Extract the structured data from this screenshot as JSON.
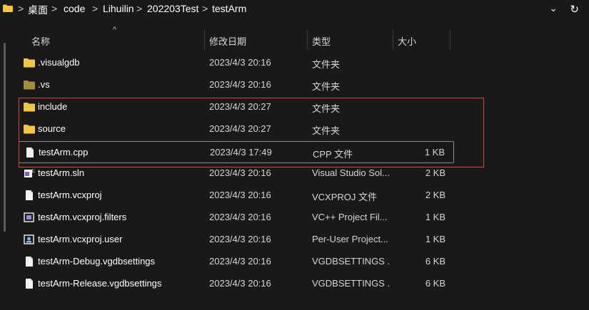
{
  "breadcrumb": {
    "items": [
      "桌面",
      "code",
      "Lihuilin",
      "202203Test",
      "testArm"
    ],
    "separator": ">"
  },
  "columns": {
    "name": "名称",
    "modified": "修改日期",
    "type": "类型",
    "size": "大小"
  },
  "files": [
    {
      "name": ".visualgdb",
      "modified": "2023/4/3 20:16",
      "type": "文件夹",
      "size": "",
      "icon": "folder-icon"
    },
    {
      "name": ".vs",
      "modified": "2023/4/3 20:16",
      "type": "文件夹",
      "size": "",
      "icon": "folder-icon"
    },
    {
      "name": "include",
      "modified": "2023/4/3 20:27",
      "type": "文件夹",
      "size": "",
      "icon": "folder-icon"
    },
    {
      "name": "source",
      "modified": "2023/4/3 20:27",
      "type": "文件夹",
      "size": "",
      "icon": "folder-icon"
    },
    {
      "name": "testArm.cpp",
      "modified": "2023/4/3 17:49",
      "type": "CPP 文件",
      "size": "1 KB",
      "icon": "file-icon"
    },
    {
      "name": "testArm.sln",
      "modified": "2023/4/3 20:16",
      "type": "Visual Studio Sol...",
      "size": "2 KB",
      "icon": "sln-file-icon"
    },
    {
      "name": "testArm.vcxproj",
      "modified": "2023/4/3 20:16",
      "type": "VCXPROJ 文件",
      "size": "2 KB",
      "icon": "file-icon"
    },
    {
      "name": "testArm.vcxproj.filters",
      "modified": "2023/4/3 20:16",
      "type": "VC++ Project Fil...",
      "size": "1 KB",
      "icon": "filters-file-icon"
    },
    {
      "name": "testArm.vcxproj.user",
      "modified": "2023/4/3 20:16",
      "type": "Per-User Project...",
      "size": "1 KB",
      "icon": "user-file-icon"
    },
    {
      "name": "testArm-Debug.vgdbsettings",
      "modified": "2023/4/3 20:16",
      "type": "VGDBSETTINGS ...",
      "size": "6 KB",
      "icon": "file-icon"
    },
    {
      "name": "testArm-Release.vgdbsettings",
      "modified": "2023/4/3 20:16",
      "type": "VGDBSETTINGS ...",
      "size": "6 KB",
      "icon": "file-icon"
    }
  ],
  "colors": {
    "background": "#191919",
    "folder": "#f4c542",
    "highlight_box": "#e0403a"
  }
}
